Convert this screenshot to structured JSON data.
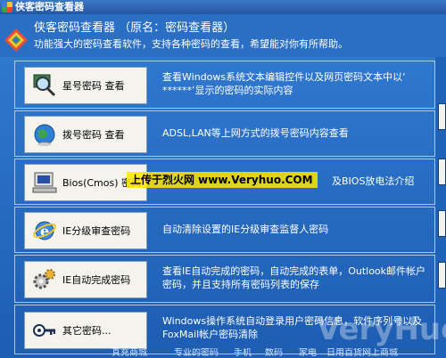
{
  "window": {
    "title": "侠客密码查看器"
  },
  "header": {
    "name": "侠客密码查看器 （原名：密码查看器）",
    "desc": "功能强大的密码查看软件，支持各种密码的查看，希望能对你有所帮助。"
  },
  "rows": [
    {
      "label": "星号密码 查看",
      "desc": "查看Windows系统文本编辑控件以及网页密码文本中以‘ ******’显示的密码的实际内容"
    },
    {
      "label": "拨号密码 查看",
      "desc": "ADSL,LAN等上网方式的拨号密码内容查看"
    },
    {
      "label": "Bios(Cmos) 密码",
      "desc": "及BIOS放电法介绍"
    },
    {
      "label": "IE分级审查密码",
      "desc": "自动清除设置的IE分级审查监督人密码"
    },
    {
      "label": "IE自动完成密码",
      "desc": "查看IE自动完成的密码，自动完成的表单，Outlook邮件帐户密码，并且支持所有密码列表的保存"
    },
    {
      "label": "其它密码...",
      "desc": "Windows操作系统自动登录用户密码信息，软件序列号以及FoxMail帐户密码清除"
    }
  ],
  "watermark": "上传于烈火网 www.Veryhuo.COM",
  "bigmark": "VeryHuo.com",
  "footer": [
    "真充商城",
    "专业的密码",
    "手机",
    "数码",
    "家电",
    "日用百货网上商城"
  ]
}
